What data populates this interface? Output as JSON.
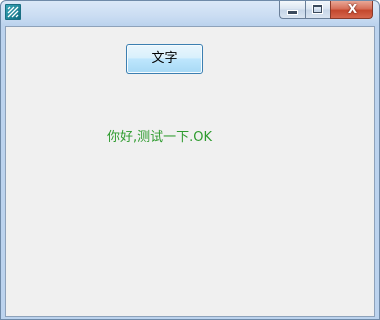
{
  "window": {
    "close_glyph": "X",
    "icon": "app-icon"
  },
  "main": {
    "button_label": "文字",
    "greeting_text": "你好,测试一下.OK"
  },
  "colors": {
    "greeting_text": "#2e9b2e",
    "client_background": "#f0f0f0",
    "close_button": "#c4472d"
  }
}
